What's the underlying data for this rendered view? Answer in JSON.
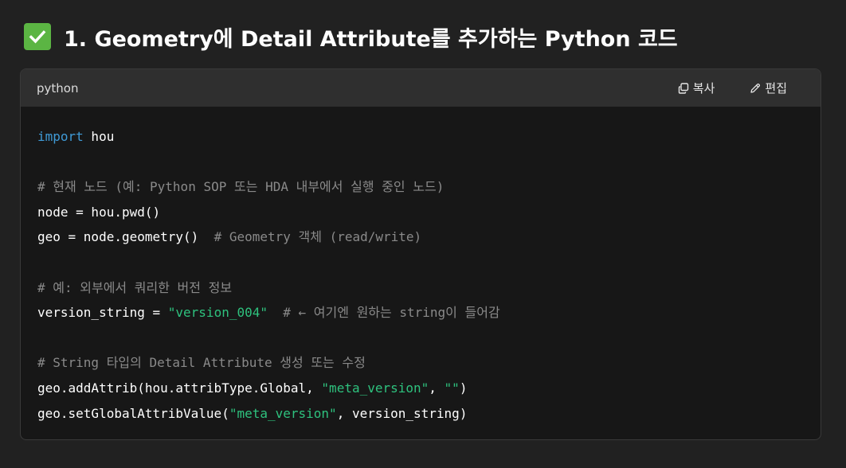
{
  "heading": {
    "title": "1. Geometry에 Detail Attribute를 추가하는 Python 코드"
  },
  "code_block": {
    "language": "python",
    "copy_label": "복사",
    "edit_label": "편집",
    "lines": {
      "l1_kw": "import",
      "l1_rest": " hou",
      "l3_cm": "# 현재 노드 (예: Python SOP 또는 HDA 내부에서 실행 중인 노드)",
      "l4": "node = hou.pwd()",
      "l5_code": "geo = node.geometry()  ",
      "l5_cm": "# Geometry 객체 (read/write)",
      "l7_cm": "# 예: 외부에서 쿼리한 버전 정보",
      "l8_code": "version_string = ",
      "l8_str": "\"version_004\"",
      "l8_gap": "  ",
      "l8_cm": "# ← 여기엔 원하는 string이 들어감",
      "l10_cm": "# String 타입의 Detail Attribute 생성 또는 수정",
      "l11_code": "geo.addAttrib(hou.attribType.Global, ",
      "l11_str1": "\"meta_version\"",
      "l11_comma": ", ",
      "l11_str2": "\"\"",
      "l11_close": ")",
      "l12_code": "geo.setGlobalAttribValue(",
      "l12_str": "\"meta_version\"",
      "l12_rest": ", version_string)"
    }
  },
  "colors": {
    "background": "#212121",
    "code_background": "#171717",
    "header_background": "#2f2f2f",
    "keyword": "#3f9ad6",
    "string": "#2ec27e",
    "comment": "#8a8a8a",
    "check_green": "#5bb543"
  },
  "icons": {
    "heading_icon": "check-mark-button-icon",
    "copy_icon": "copy-icon",
    "edit_icon": "pencil-icon"
  }
}
